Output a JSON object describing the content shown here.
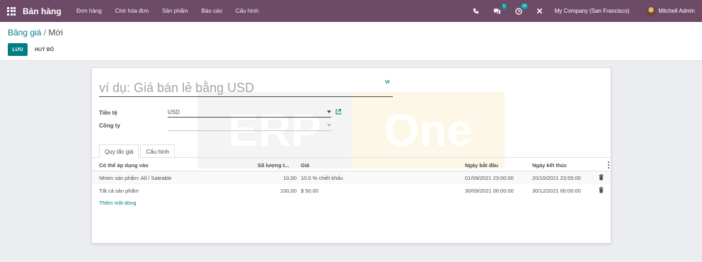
{
  "navbar": {
    "app_name": "Bán hàng",
    "menu": [
      "Đơn hàng",
      "Chờ hóa đơn",
      "Sản phẩm",
      "Báo cáo",
      "Cấu hình"
    ],
    "messages_badge": "5",
    "activities_badge": "28",
    "company": "My Company (San Francisco)",
    "user": "Mitchell Admin"
  },
  "breadcrumb": {
    "parent": "Bảng giá",
    "separator": "/",
    "current": "Mới"
  },
  "buttons": {
    "save": "LƯU",
    "discard": "HUỶ BỎ"
  },
  "form": {
    "name_placeholder": "ví dụ: Giá bán lẻ bằng USD",
    "lang": "VI",
    "currency_label": "Tiền tệ",
    "currency_value": "USD",
    "company_label": "Công ty",
    "company_value": ""
  },
  "watermark": {
    "left": "ERP",
    "right": "One"
  },
  "tabs": [
    "Quy tắc giá",
    "Cấu hình"
  ],
  "table": {
    "columns": [
      "Có thể áp dụng vào",
      "Số lượng t...",
      "Giá",
      "Ngày bắt đầu",
      "Ngày kết thúc"
    ],
    "rows": [
      {
        "apply": "Nhóm sản phẩm: All / Saleable",
        "qty": "10,00",
        "price": "10.0 % chiết khấu",
        "start": "01/09/2021 23:00:00",
        "end": "20/10/2021 23:55:00"
      },
      {
        "apply": "Tất cả sản phẩm",
        "qty": "100,00",
        "price": "$ 50.00",
        "start": "30/09/2021 00:00:00",
        "end": "30/12/2021 00:00:00"
      }
    ],
    "add_line": "Thêm một dòng"
  },
  "colors": {
    "navbar": "#6d4b67",
    "primary": "#017e84",
    "badge": "#00a09d"
  }
}
